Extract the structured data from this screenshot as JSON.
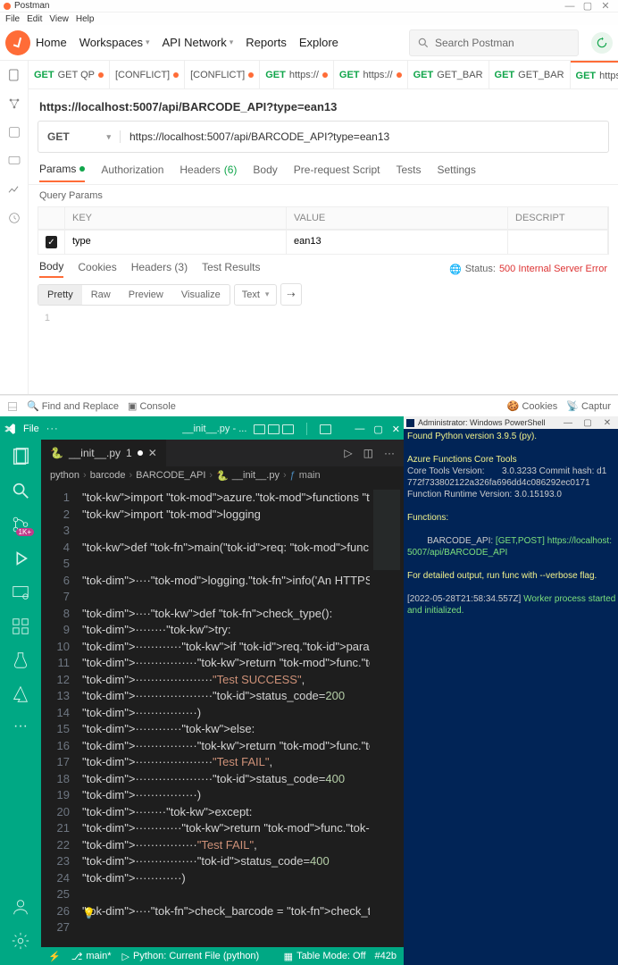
{
  "postman": {
    "titlebar": {
      "app_name": "Postman"
    },
    "menubar": [
      "File",
      "Edit",
      "View",
      "Help"
    ],
    "toolbar": {
      "nav": [
        "Home",
        "Workspaces",
        "API Network",
        "Reports",
        "Explore"
      ],
      "search_placeholder": "Search Postman"
    },
    "tabs": [
      {
        "method": "GET",
        "label": "GET QP",
        "unsaved": true
      },
      {
        "method": "",
        "label": "[CONFLICT]",
        "unsaved": true
      },
      {
        "method": "",
        "label": "[CONFLICT]",
        "unsaved": true
      },
      {
        "method": "GET",
        "label": "https://",
        "unsaved": true
      },
      {
        "method": "GET",
        "label": "https://",
        "unsaved": true
      },
      {
        "method": "GET",
        "label": "GET_BAR",
        "unsaved": false
      },
      {
        "method": "GET",
        "label": "GET_BAR",
        "unsaved": false
      },
      {
        "method": "GET",
        "label": "https://",
        "unsaved": true,
        "active": true
      }
    ],
    "request_name": "https://localhost:5007/api/BARCODE_API?type=ean13",
    "method": "GET",
    "url": "https://localhost:5007/api/BARCODE_API?type=ean13",
    "subtabs": {
      "params": "Params",
      "auth": "Authorization",
      "headers": "Headers",
      "headers_cnt": "(6)",
      "body": "Body",
      "prereq": "Pre-request Script",
      "tests": "Tests",
      "settings": "Settings"
    },
    "section_title": "Query Params",
    "table_header": {
      "key": "KEY",
      "value": "VALUE",
      "desc": "DESCRIPT"
    },
    "table_row": {
      "key": "type",
      "value": "ean13"
    },
    "resp_tabs": {
      "body": "Body",
      "cookies": "Cookies",
      "headers": "Headers",
      "headers_cnt": "(3)",
      "test": "Test Results"
    },
    "status_label": "Status:",
    "status_value": "500 Internal Server Error",
    "view_modes": [
      "Pretty",
      "Raw",
      "Preview",
      "Visualize"
    ],
    "resp_lang": "Text",
    "resp_line_no": "1",
    "footer": {
      "find": "Find and Replace",
      "console": "Console",
      "cookies": "Cookies",
      "capture": "Captur"
    }
  },
  "vscode": {
    "titlebar": {
      "menu_file": "File",
      "tab_name": "__init__.py - ..."
    },
    "tab": {
      "name": "__init__.py",
      "dirty": "1"
    },
    "breadcrumb": [
      "python",
      "barcode",
      "BARCODE_API",
      "__init__.py",
      "main"
    ],
    "rail_badge": "1K+",
    "status": {
      "branch": "main*",
      "debug": "Python: Current File (python)",
      "table": "Table Mode: Off",
      "col": "#42b"
    },
    "code_lines": [
      "import azure.functions as func",
      "import logging",
      "",
      "def main(req: func.HttpRequest) -> func",
      "",
      "    logging.info('An HTTPS trigger has",
      "",
      "    def check_type():",
      "        try:",
      "            if req.params.get('type'):",
      "                return func.HttpRespons",
      "                    \"Test SUCCESS\",",
      "                    status_code=200",
      "                )",
      "            else:",
      "                return func.HttpRespons",
      "                    \"Test FAIL\",",
      "                    status_code=400",
      "                )",
      "        except:",
      "            return func.HttpResponse(",
      "                \"Test FAIL\",",
      "                status_code=400",
      "            )",
      "",
      "    check_barcode = check_type()",
      ""
    ]
  },
  "powershell": {
    "title": "Administrator: Windows PowerShell",
    "lines": [
      {
        "cls": "ps-yel",
        "t": "Found Python version 3.9.5 (py)."
      },
      {
        "cls": "",
        "t": ""
      },
      {
        "cls": "ps-yel",
        "t": "Azure Functions Core Tools"
      },
      {
        "cls": "",
        "t": "Core Tools Version:       3.0.3233 Commit hash: d1"
      },
      {
        "cls": "",
        "t": "772f733802122a326fa696dd4c086292ec0171"
      },
      {
        "cls": "",
        "t": "Function Runtime Version: 3.0.15193.0"
      },
      {
        "cls": "",
        "t": ""
      },
      {
        "cls": "ps-yel",
        "t": "Functions:"
      },
      {
        "cls": "",
        "t": ""
      },
      {
        "cls": "",
        "t": "        BARCODE_API: ",
        "tail_cls": "ps-grn",
        "tail": "[GET,POST] https://localhost:"
      },
      {
        "cls": "ps-grn",
        "t": "5007/api/BARCODE_API"
      },
      {
        "cls": "",
        "t": ""
      },
      {
        "cls": "ps-yel",
        "t": "For detailed output, run func with --verbose flag."
      },
      {
        "cls": "",
        "t": ""
      },
      {
        "cls": "",
        "t": "[2022-05-28T21:58:34.557Z] ",
        "tail_cls": "ps-grn",
        "tail": "Worker process started"
      },
      {
        "cls": "ps-grn",
        "t": "and initialized."
      }
    ]
  }
}
